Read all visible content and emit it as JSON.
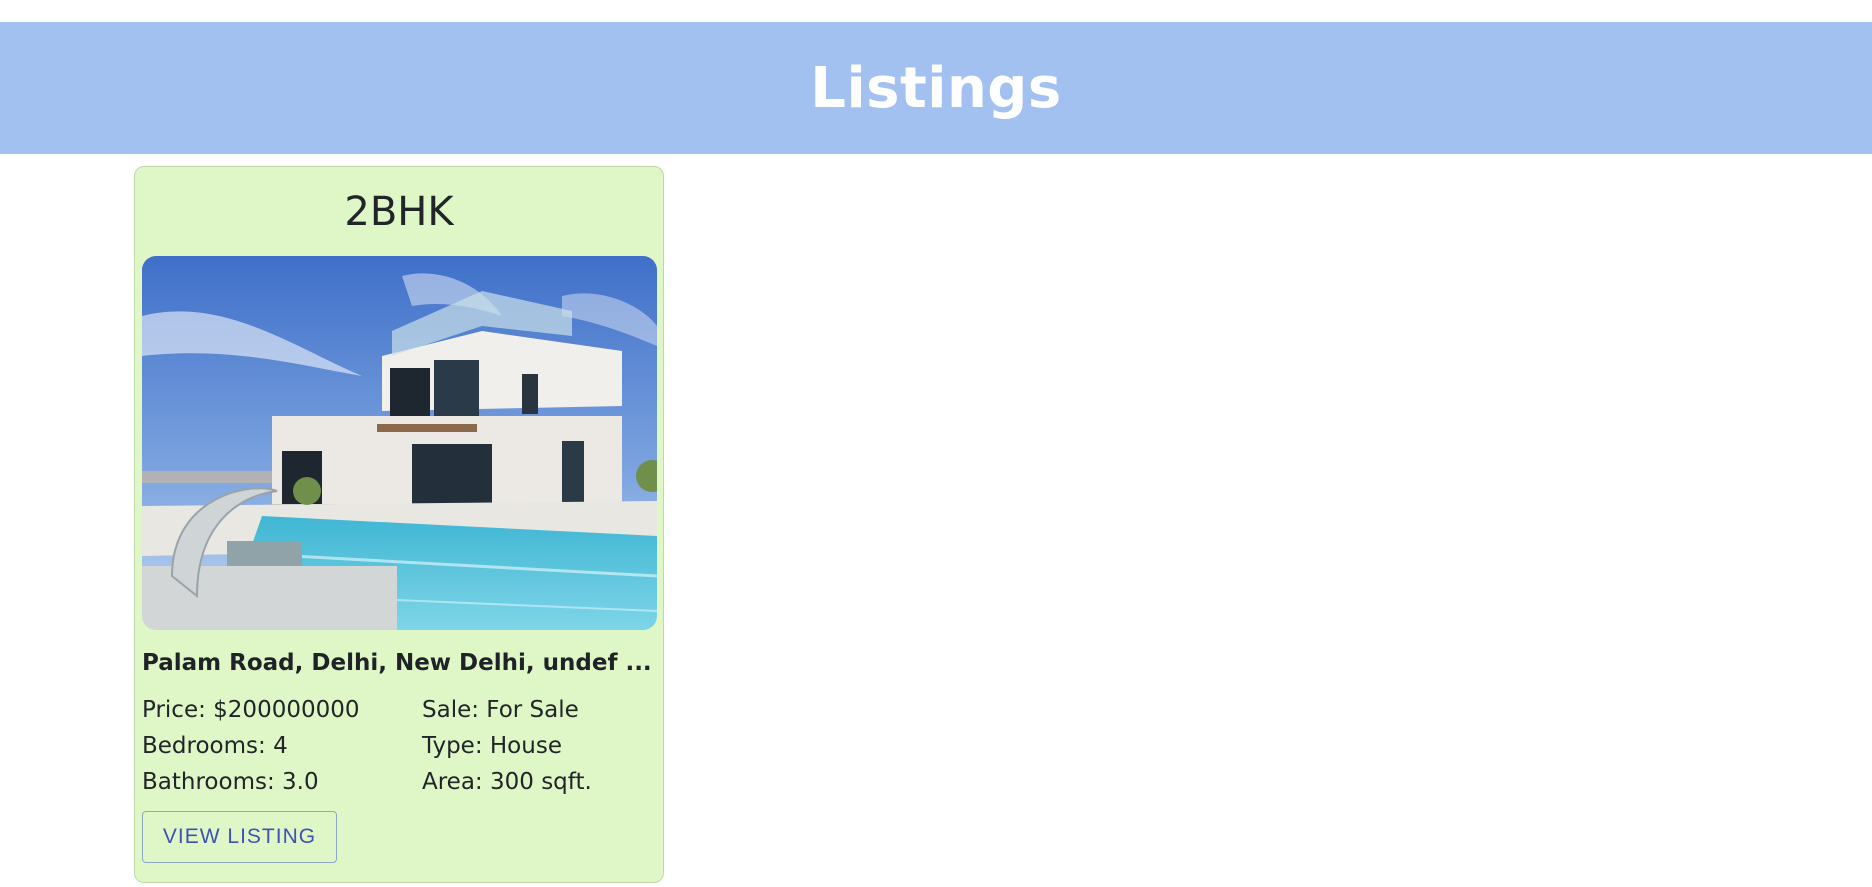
{
  "header": {
    "title": "Listings",
    "background_color": "#a2c0f0"
  },
  "listings": [
    {
      "title": "2BHK",
      "image": "luxury-house-with-pool-photo",
      "address": "Palam Road, Delhi, New Delhi, undef ...",
      "price": "Price: $200000000",
      "sale": "Sale: For Sale",
      "bedrooms": "Bedrooms: 4",
      "type": "Type: House",
      "bathrooms": "Bathrooms: 3.0",
      "area": "Area: 300 sqft.",
      "button_label": "VIEW LISTING",
      "card_color": "#dff7c7",
      "button_color": "#3f51b5"
    }
  ]
}
